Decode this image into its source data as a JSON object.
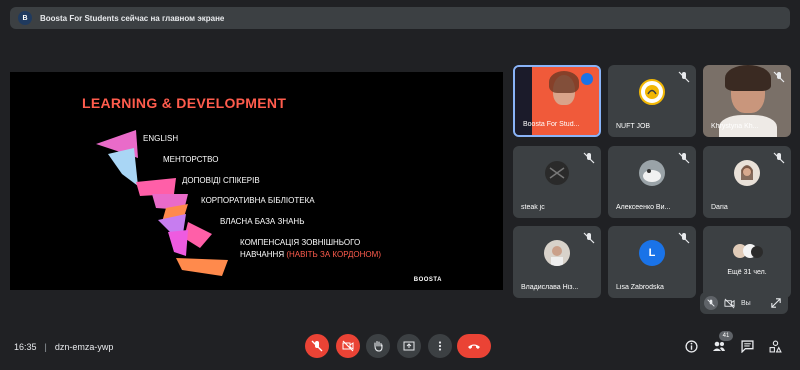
{
  "banner": {
    "avatar_letter": "B",
    "text": "Boosta For Students сейчас на главном экране"
  },
  "slide": {
    "title": "LEARNING & DEVELOPMENT",
    "items": [
      "ENGLISH",
      "МЕНТОРСТВО",
      "ДОПОВІДІ СПІКЕРІВ",
      "КОРПОРАТИВНА БІБЛІОТЕКА",
      "ВЛАСНА БАЗА ЗНАНЬ",
      "КОМПЕНСАЦІЯ ЗОВНІШНЬОГО"
    ],
    "last_line": "НАВЧАННЯ",
    "last_line_highlight": "(НАВІТЬ ЗА КОРДОНОМ)",
    "logo": "BOOSTA",
    "accent": "#ff5c4d"
  },
  "participants": [
    {
      "name": "Boosta For Stud...",
      "icon": "video-thumbnail"
    },
    {
      "name": "NUFT JOB",
      "icon": "logo-avatar"
    },
    {
      "name": "Khrystyna Kh...",
      "icon": "video-thumbnail"
    },
    {
      "name": "steak jc",
      "icon": "avatar"
    },
    {
      "name": "Алексеенко Ви...",
      "icon": "avatar"
    },
    {
      "name": "Daria",
      "icon": "avatar"
    },
    {
      "name": "Владислава Ніз...",
      "icon": "avatar"
    },
    {
      "name": "Lisa Zabrodska",
      "icon": "letter-avatar",
      "letter": "L"
    },
    {
      "name": "Ещё 31 чел.",
      "icon": "more-avatars"
    }
  ],
  "self_bar": {
    "label": "Вы"
  },
  "footer": {
    "time": "16:35",
    "code": "dzn-emza-ywp",
    "participants_count": "41"
  },
  "colors": {
    "red": "#ea4335",
    "tile": "#3c4043",
    "bg": "#202124",
    "blue": "#1a73e8"
  }
}
